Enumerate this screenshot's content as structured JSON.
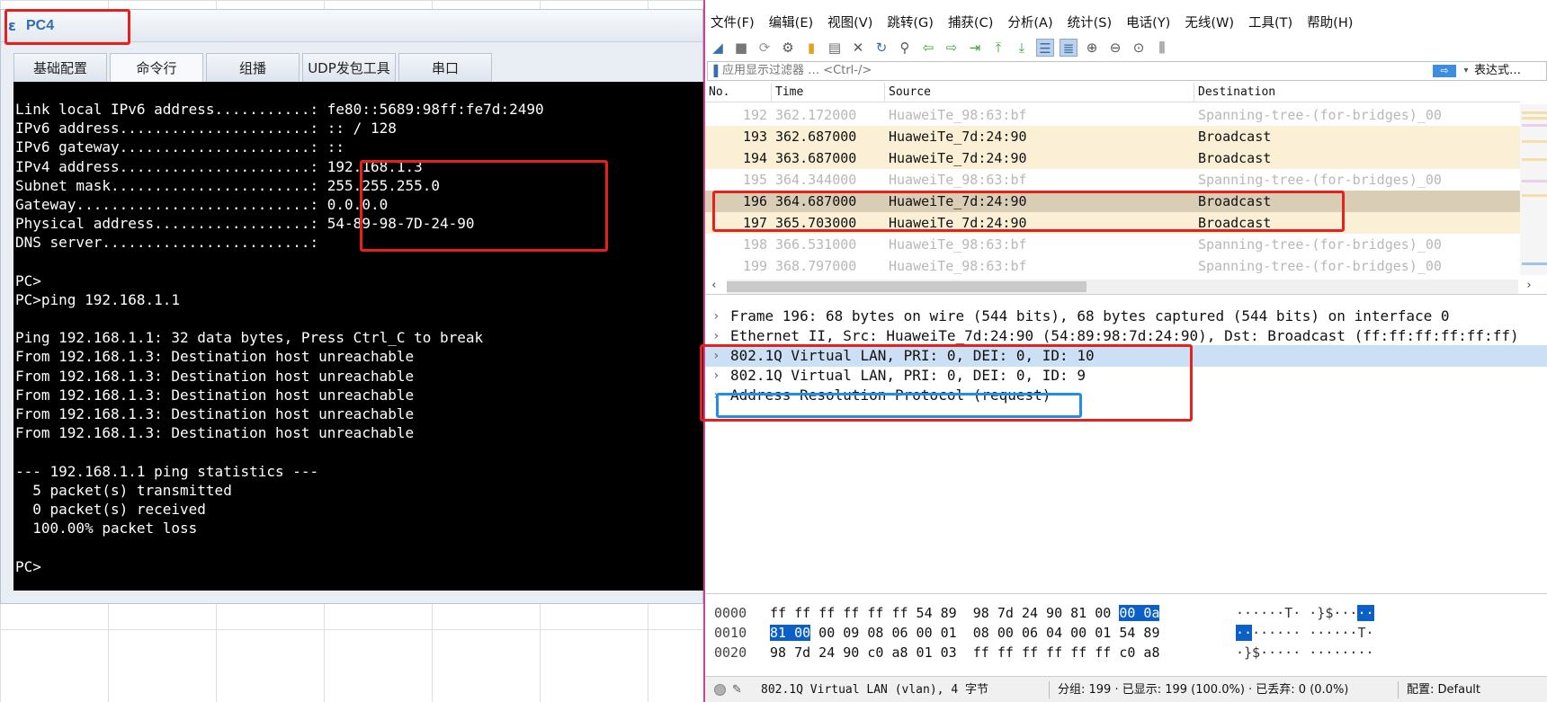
{
  "pc_window": {
    "title": "PC4",
    "tabs": [
      "基础配置",
      "命令行",
      "组播",
      "UDP发包工具",
      "串口"
    ],
    "active_tab": "命令行",
    "terminal_lines": [
      "Link local IPv6 address...........: fe80::5689:98ff:fe7d:2490",
      "IPv6 address......................: :: / 128",
      "IPv6 gateway......................: ::",
      "IPv4 address......................: 192.168.1.3",
      "Subnet mask.......................: 255.255.255.0",
      "Gateway...........................: 0.0.0.0",
      "Physical address..................: 54-89-98-7D-24-90",
      "DNS server........................:",
      "",
      "PC>",
      "PC>ping 192.168.1.1",
      "",
      "Ping 192.168.1.1: 32 data bytes, Press Ctrl_C to break",
      "From 192.168.1.3: Destination host unreachable",
      "From 192.168.1.3: Destination host unreachable",
      "From 192.168.1.3: Destination host unreachable",
      "From 192.168.1.3: Destination host unreachable",
      "From 192.168.1.3: Destination host unreachable",
      "",
      "--- 192.168.1.1 ping statistics ---",
      "  5 packet(s) transmitted",
      "  0 packet(s) received",
      "  100.00% packet loss",
      "",
      "PC>"
    ]
  },
  "wireshark": {
    "menu": [
      "文件(F)",
      "编辑(E)",
      "视图(V)",
      "跳转(G)",
      "捕获(C)",
      "分析(A)",
      "统计(S)",
      "电话(Y)",
      "无线(W)",
      "工具(T)",
      "帮助(H)"
    ],
    "filter": {
      "placeholder": "应用显示过滤器 … <Ctrl-/>",
      "expression_label": "表达式…"
    },
    "columns": [
      "No.",
      "Time",
      "Source",
      "Destination"
    ],
    "packets": [
      {
        "no": "192",
        "time": "362.172000",
        "source": "HuaweiTe_98:63:bf",
        "destination": "Spanning-tree-(for-bridges)_00",
        "style": "dim"
      },
      {
        "no": "193",
        "time": "362.687000",
        "source": "HuaweiTe_7d:24:90",
        "destination": "Broadcast",
        "style": "yellow"
      },
      {
        "no": "194",
        "time": "363.687000",
        "source": "HuaweiTe_7d:24:90",
        "destination": "Broadcast",
        "style": "yellow"
      },
      {
        "no": "195",
        "time": "364.344000",
        "source": "HuaweiTe_98:63:bf",
        "destination": "Spanning-tree-(for-bridges)_00",
        "style": "dim"
      },
      {
        "no": "196",
        "time": "364.687000",
        "source": "HuaweiTe_7d:24:90",
        "destination": "Broadcast",
        "style": "selected"
      },
      {
        "no": "197",
        "time": "365.703000",
        "source": "HuaweiTe_7d:24:90",
        "destination": "Broadcast",
        "style": "yellow"
      },
      {
        "no": "198",
        "time": "366.531000",
        "source": "HuaweiTe_98:63:bf",
        "destination": "Spanning-tree-(for-bridges)_00",
        "style": "dim"
      },
      {
        "no": "199",
        "time": "368.797000",
        "source": "HuaweiTe_98:63:bf",
        "destination": "Spanning-tree-(for-bridges)_00",
        "style": "dim"
      }
    ],
    "details": [
      "Frame 196: 68 bytes on wire (544 bits), 68 bytes captured (544 bits) on interface 0",
      "Ethernet II, Src: HuaweiTe_7d:24:90 (54:89:98:7d:24:90), Dst: Broadcast (ff:ff:ff:ff:ff:ff)",
      "802.1Q Virtual LAN, PRI: 0, DEI: 0, ID: 10",
      "802.1Q Virtual LAN, PRI: 0, DEI: 0, ID: 9",
      "Address Resolution Protocol (request)"
    ],
    "bytes": [
      {
        "offset": "0000",
        "hex_a": "ff ff ff ff ff ff 54 89  98 7d 24 90 81 00 ",
        "hex_sel": "00 0a",
        "hex_b": "",
        "ascii_a": "······T· ·}$···",
        "ascii_sel": "··",
        "ascii_b": ""
      },
      {
        "offset": "0010",
        "hex_a": "",
        "hex_sel": "81 00",
        "hex_b": " 00 09 08 06 00 01  08 00 06 04 00 01 54 89",
        "ascii_a": "",
        "ascii_sel": "··",
        "ascii_b": "······ ······T·"
      },
      {
        "offset": "0020",
        "hex_a": "98 7d 24 90 c0 a8 01 03  ff ff ff ff ff ff c0 a8",
        "hex_sel": "",
        "hex_b": "",
        "ascii_a": "·}$····· ········",
        "ascii_sel": "",
        "ascii_b": ""
      }
    ],
    "status": {
      "field": "802.1Q Virtual LAN (vlan), 4 字节",
      "stats": "分组: 199 · 已显示: 199 (100.0%) · 已丢弃: 0 (0.0%)",
      "profile": "配置: Default"
    }
  }
}
